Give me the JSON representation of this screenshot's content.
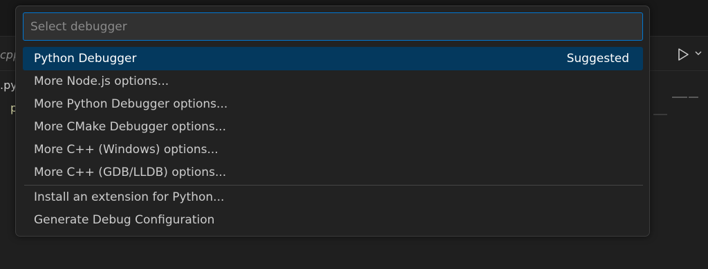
{
  "editor": {
    "tab_fragment": "cpp",
    "file_fragment": ".py",
    "code_fragment": "p",
    "run_icon": "play-icon",
    "dropdown_icon": "chevron-down-icon"
  },
  "quickpick": {
    "placeholder": "Select debugger",
    "value": "",
    "items": [
      {
        "label": "Python Debugger",
        "description": "Suggested",
        "selected": true
      },
      {
        "label": "More Node.js options..."
      },
      {
        "label": "More Python Debugger options..."
      },
      {
        "label": "More CMake Debugger options..."
      },
      {
        "label": "More C++ (Windows) options..."
      },
      {
        "label": "More C++ (GDB/LLDB) options..."
      },
      {
        "label": "Install an extension for Python..."
      },
      {
        "label": "Generate Debug Configuration"
      }
    ]
  },
  "colors": {
    "accent": "#0078d4",
    "selection_bg": "#04395e",
    "widget_bg": "#222222",
    "editor_bg": "#1f1f1f"
  }
}
